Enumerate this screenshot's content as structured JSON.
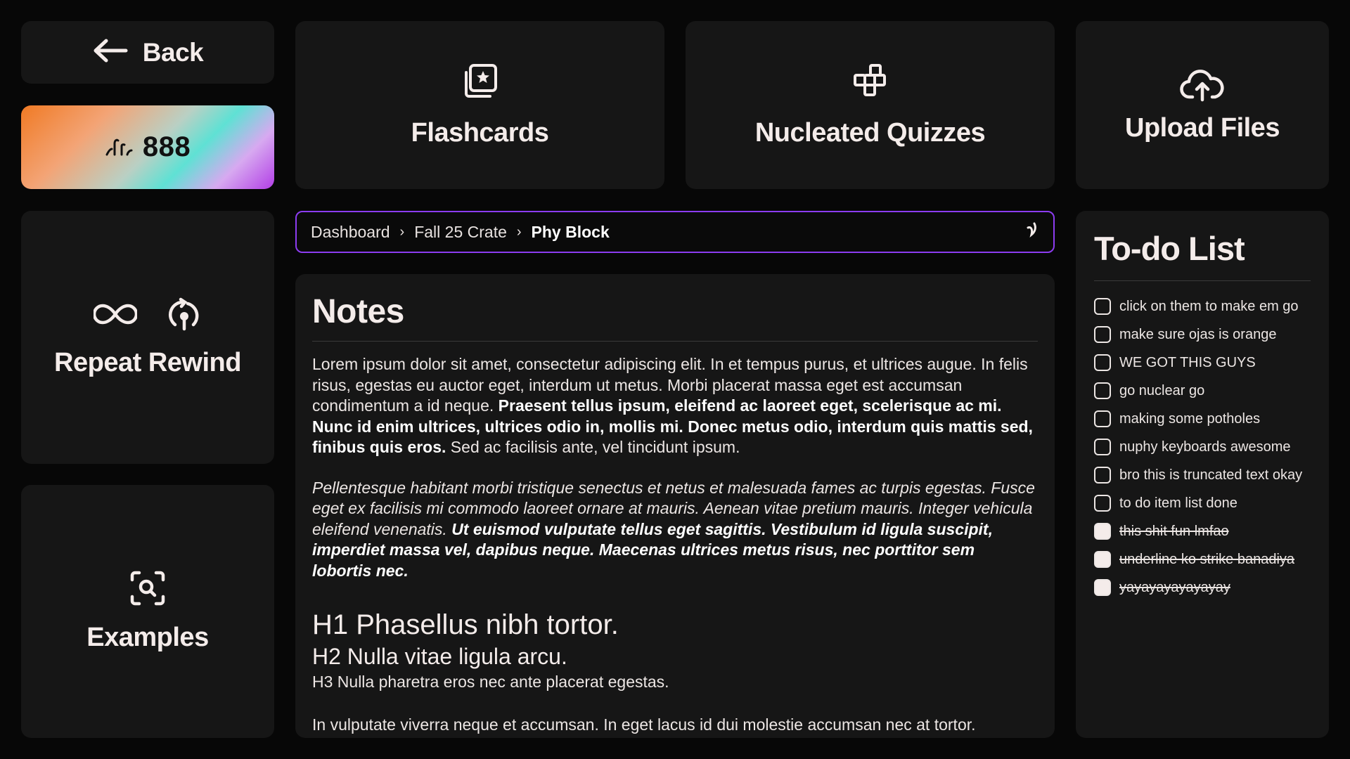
{
  "nav": {
    "back_label": "Back"
  },
  "score": {
    "value": "888"
  },
  "tiles": {
    "flashcards": "Flashcards",
    "quizzes": "Nucleated Quizzes",
    "upload": "Upload Files",
    "repeat": "Repeat Rewind",
    "examples": "Examples"
  },
  "breadcrumb": {
    "items": [
      "Dashboard",
      "Fall 25 Crate"
    ],
    "current": "Phy Block",
    "separator": "›"
  },
  "notes": {
    "title": "Notes",
    "p1_plain": "Lorem ipsum dolor sit amet, consectetur adipiscing elit. In et tempus purus, et ultrices augue. In felis risus, egestas eu auctor eget, interdum ut metus. Morbi placerat massa eget est accumsan condimentum a id neque. ",
    "p1_bold": "Praesent tellus ipsum, eleifend ac laoreet eget, scelerisque ac mi. Nunc id enim ultrices, ultrices odio in, mollis mi. Donec metus odio, interdum quis mattis sed, finibus quis eros.",
    "p1_tail": " Sed ac facilisis ante, vel tincidunt ipsum.",
    "p2_italic": "Pellentesque habitant morbi tristique senectus et netus et malesuada fames ac turpis egestas. Fusce eget ex facilisis mi commodo laoreet ornare at mauris. Aenean vitae pretium mauris. Integer vehicula eleifend venenatis. ",
    "p2_bold_italic": "Ut euismod vulputate tellus eget sagittis. Vestibulum id ligula suscipit, imperdiet massa vel, dapibus neque. Maecenas ultrices metus risus, nec porttitor sem lobortis nec.",
    "h1": "H1 Phasellus nibh tortor.",
    "h2": "H2 Nulla vitae ligula arcu.",
    "h3": "H3 Nulla pharetra eros nec ante placerat egestas.",
    "p3": "In vulputate viverra neque et accumsan. In eget lacus id dui molestie accumsan nec at tortor."
  },
  "todo": {
    "title": "To-do List",
    "items": [
      {
        "text": "click on them to make em go",
        "done": false
      },
      {
        "text": "make sure ojas is orange",
        "done": false
      },
      {
        "text": "WE GOT THIS GUYS",
        "done": false
      },
      {
        "text": "go nuclear go",
        "done": false
      },
      {
        "text": "making some potholes",
        "done": false
      },
      {
        "text": "nuphy keyboards awesome",
        "done": false
      },
      {
        "text": "bro this is truncated text okay",
        "done": false
      },
      {
        "text": "to do item list done",
        "done": false
      },
      {
        "text": "this shit fun lmfao",
        "done": true
      },
      {
        "text": "underline ko strike banadiya",
        "done": true
      },
      {
        "text": "yayayayayayayay",
        "done": true
      }
    ]
  },
  "colors": {
    "background": "#070707",
    "card": "#161616",
    "accent_border": "#8c3cf0",
    "text": "#f4ecea"
  },
  "icons": [
    "arrow-left-icon",
    "streak-icon",
    "flashcard-star-icon",
    "blocks-icon",
    "cloud-upload-icon",
    "infinity-icon",
    "rewind-icon",
    "scan-search-icon",
    "spinner-icon"
  ]
}
